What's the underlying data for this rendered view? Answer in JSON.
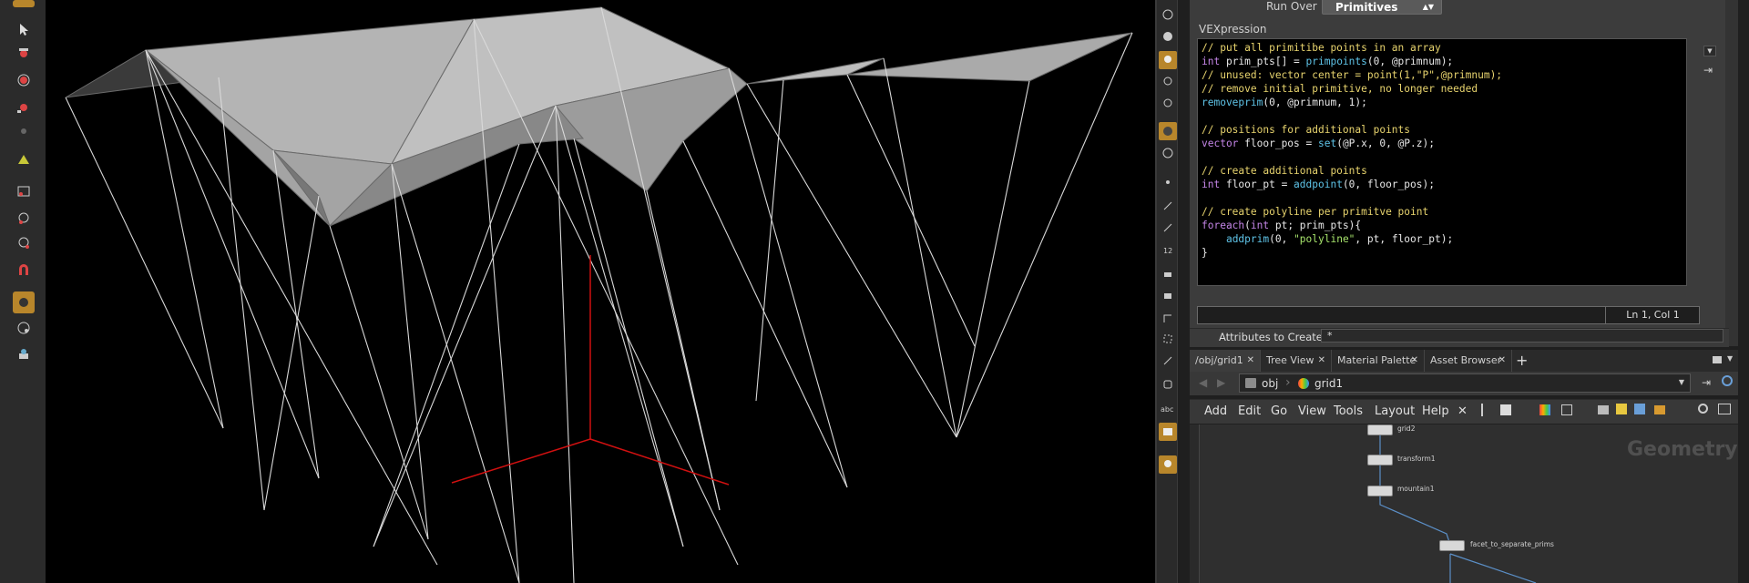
{
  "viewport": {
    "label": "3D scene viewport"
  },
  "params": {
    "run_over_label": "Run Over",
    "run_over_value": "Primitives",
    "vexpression_label": "VEXpression",
    "code": [
      [
        {
          "t": "// put all primitibe points in an array",
          "c": "cm"
        }
      ],
      [
        {
          "t": "int",
          "c": "kw"
        },
        {
          "t": " prim_pts[] = ",
          "c": "pl"
        },
        {
          "t": "primpoints",
          "c": "fn"
        },
        {
          "t": "(0, @primnum);",
          "c": "pl"
        }
      ],
      [
        {
          "t": "// unused: vector center = point(1,\"P\",@primnum);",
          "c": "cm"
        }
      ],
      [
        {
          "t": "// remove initial primitive, no longer needed",
          "c": "cm"
        }
      ],
      [
        {
          "t": "removeprim",
          "c": "fn"
        },
        {
          "t": "(0, @primnum, 1);",
          "c": "pl"
        }
      ],
      [
        {
          "t": "",
          "c": "pl"
        }
      ],
      [
        {
          "t": "// positions for additional points",
          "c": "cm"
        }
      ],
      [
        {
          "t": "vector",
          "c": "kw"
        },
        {
          "t": " floor_pos = ",
          "c": "pl"
        },
        {
          "t": "set",
          "c": "fn"
        },
        {
          "t": "(@P.x, 0, @P.z);",
          "c": "pl"
        }
      ],
      [
        {
          "t": "",
          "c": "pl"
        }
      ],
      [
        {
          "t": "// create additional points",
          "c": "cm"
        }
      ],
      [
        {
          "t": "int",
          "c": "kw"
        },
        {
          "t": " floor_pt = ",
          "c": "pl"
        },
        {
          "t": "addpoint",
          "c": "fn"
        },
        {
          "t": "(0, floor_pos);",
          "c": "pl"
        }
      ],
      [
        {
          "t": "",
          "c": "pl"
        }
      ],
      [
        {
          "t": "// create polyline per primitve point",
          "c": "cm"
        }
      ],
      [
        {
          "t": "foreach",
          "c": "kw"
        },
        {
          "t": "(",
          "c": "pl"
        },
        {
          "t": "int",
          "c": "kw"
        },
        {
          "t": " pt; prim_pts){",
          "c": "pl"
        }
      ],
      [
        {
          "t": "    ",
          "c": "pl"
        },
        {
          "t": "addprim",
          "c": "fn"
        },
        {
          "t": "(0, ",
          "c": "pl"
        },
        {
          "t": "\"polyline\"",
          "c": "st"
        },
        {
          "t": ", pt, floor_pt);",
          "c": "pl"
        }
      ],
      [
        {
          "t": "}",
          "c": "pl"
        }
      ]
    ],
    "cursor_pos": "Ln 1, Col 1",
    "attributes_label": "Attributes to Create",
    "attributes_value": "*"
  },
  "network": {
    "tabs": [
      {
        "label": "/obj/grid1",
        "active": true
      },
      {
        "label": "Tree View",
        "active": false
      },
      {
        "label": "Material Palette",
        "active": false
      },
      {
        "label": "Asset Browser",
        "active": false
      }
    ],
    "path": {
      "root": "obj",
      "node": "grid1"
    },
    "menu": [
      "Add",
      "Edit",
      "Go",
      "View",
      "Tools",
      "Layout",
      "Help"
    ],
    "context_label": "Geometry",
    "nodes": [
      "grid2",
      "transform1",
      "mountain1",
      "facet_to_separate_prims"
    ]
  },
  "colors": {
    "accent": "#b8862b",
    "axis": "#d01010",
    "surface": "#a8a8a8"
  }
}
